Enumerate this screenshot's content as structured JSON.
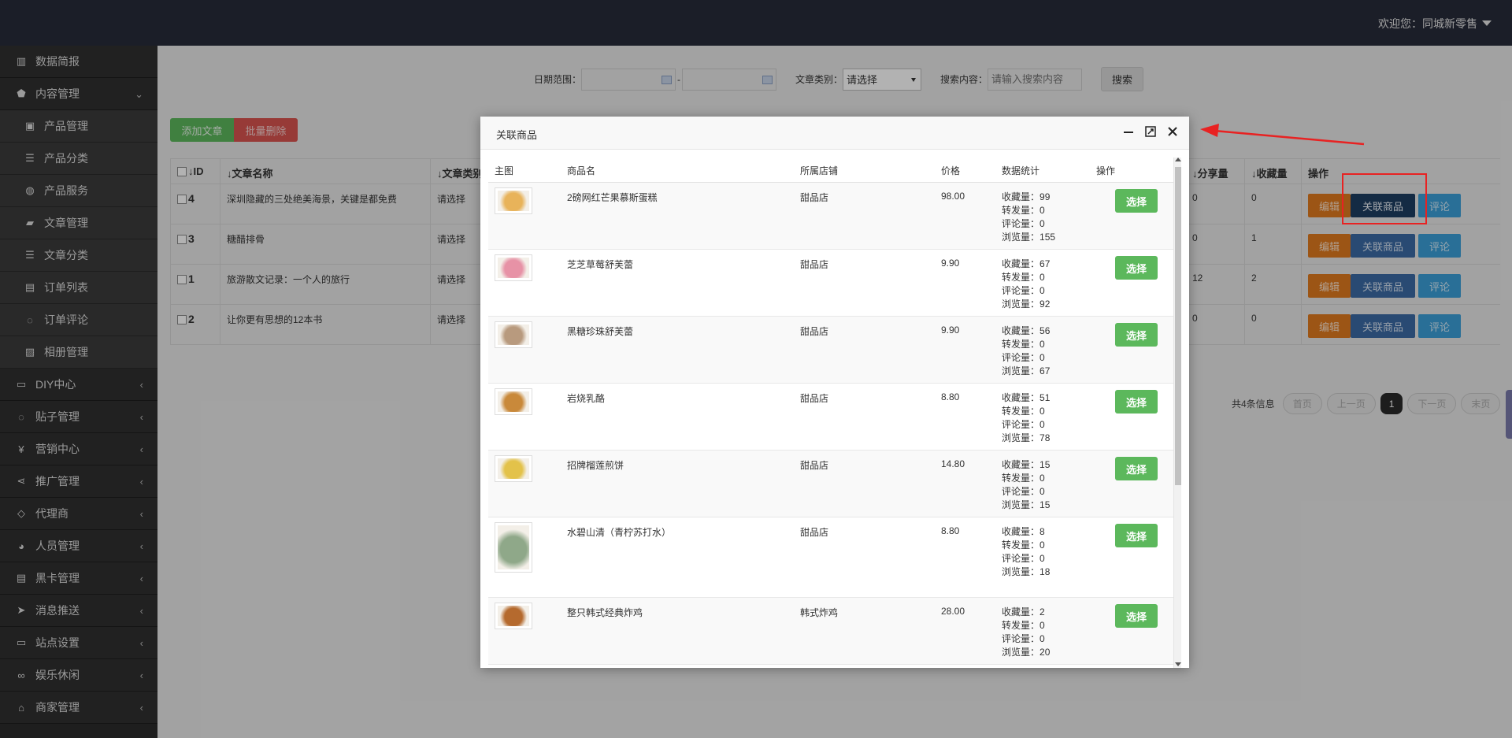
{
  "topbar": {
    "welcome": "欢迎您：同城新零售"
  },
  "sidebar": {
    "items": [
      {
        "label": "数据简报",
        "icon": "bar-chart-icon",
        "sub": false,
        "arrow": ""
      },
      {
        "label": "内容管理",
        "icon": "tags-icon",
        "sub": false,
        "arrow": "⌄"
      },
      {
        "label": "产品管理",
        "icon": "shopping-bag-icon",
        "sub": true,
        "arrow": ""
      },
      {
        "label": "产品分类",
        "icon": "list-icon",
        "sub": true,
        "arrow": ""
      },
      {
        "label": "产品服务",
        "icon": "globe-icon",
        "sub": true,
        "arrow": ""
      },
      {
        "label": "文章管理",
        "icon": "book-icon",
        "sub": true,
        "arrow": ""
      },
      {
        "label": "文章分类",
        "icon": "list-icon",
        "sub": true,
        "arrow": ""
      },
      {
        "label": "订单列表",
        "icon": "id-card-icon",
        "sub": true,
        "arrow": ""
      },
      {
        "label": "订单评论",
        "icon": "comment-icon",
        "sub": true,
        "arrow": ""
      },
      {
        "label": "相册管理",
        "icon": "image-icon",
        "sub": true,
        "arrow": ""
      },
      {
        "label": "DIY中心",
        "icon": "desktop-icon",
        "sub": false,
        "arrow": "‹"
      },
      {
        "label": "贴子管理",
        "icon": "comment-icon",
        "sub": false,
        "arrow": "‹"
      },
      {
        "label": "营销中心",
        "icon": "yen-icon",
        "sub": false,
        "arrow": "‹"
      },
      {
        "label": "推广管理",
        "icon": "share-icon",
        "sub": false,
        "arrow": "‹"
      },
      {
        "label": "代理商",
        "icon": "diamond-icon",
        "sub": false,
        "arrow": "‹"
      },
      {
        "label": "人员管理",
        "icon": "users-icon",
        "sub": false,
        "arrow": "‹"
      },
      {
        "label": "黑卡管理",
        "icon": "id-card-icon",
        "sub": false,
        "arrow": "‹"
      },
      {
        "label": "消息推送",
        "icon": "paper-plane-icon",
        "sub": false,
        "arrow": "‹"
      },
      {
        "label": "站点设置",
        "icon": "desktop-icon",
        "sub": false,
        "arrow": "‹"
      },
      {
        "label": "娱乐休闲",
        "icon": "gamepad-icon",
        "sub": false,
        "arrow": "‹"
      },
      {
        "label": "商家管理",
        "icon": "bank-icon",
        "sub": false,
        "arrow": "‹"
      }
    ],
    "icons": {
      "bar-chart-icon": "▥",
      "tags-icon": "⬟",
      "shopping-bag-icon": "▣",
      "list-icon": "☰",
      "globe-icon": "◍",
      "book-icon": "▰",
      "id-card-icon": "▤",
      "comment-icon": "◌",
      "image-icon": "▨",
      "desktop-icon": "▭",
      "yen-icon": "¥",
      "share-icon": "⋖",
      "diamond-icon": "◇",
      "users-icon": "◕",
      "paper-plane-icon": "➤",
      "gamepad-icon": "∞",
      "bank-icon": "⌂"
    }
  },
  "filter": {
    "date_label": "日期范围：",
    "date_sep": "-",
    "category_label": "文章类别：",
    "category_value": "请选择",
    "search_label": "搜索内容：",
    "search_placeholder": "请输入搜索内容",
    "search_button": "搜索"
  },
  "actions": {
    "add": "添加文章",
    "batch_delete": "批量删除"
  },
  "table": {
    "headers": {
      "id": "ID",
      "title": "文章名称",
      "category": "文章类别",
      "share": "分享量",
      "fav": "收藏量",
      "op": "操作"
    },
    "sort_arrow": "↓",
    "rows": [
      {
        "id": "4",
        "title": "深圳隐藏的三处绝美海景，关键是都免费",
        "category": "请选择",
        "share": "0",
        "fav": "0"
      },
      {
        "id": "3",
        "title": "糖醋排骨",
        "category": "请选择",
        "share": "0",
        "fav": "1"
      },
      {
        "id": "1",
        "title": "旅游散文记录：一个人的旅行",
        "category": "请选择",
        "share": "12",
        "fav": "2"
      },
      {
        "id": "2",
        "title": "让你更有思想的12本书",
        "category": "请选择",
        "share": "0",
        "fav": "0"
      }
    ],
    "op_labels": {
      "edit": "编辑",
      "link": "关联商品",
      "comment": "评论"
    }
  },
  "pager": {
    "total": "共4条信息",
    "first": "首页",
    "prev": "上一页",
    "current": "1",
    "next": "下一页",
    "last": "末页"
  },
  "modal": {
    "title": "关联商品",
    "headers": {
      "img": "主图",
      "name": "商品名",
      "shop": "所属店铺",
      "price": "价格",
      "stats": "数据统计",
      "op": "操作"
    },
    "select_label": "选择",
    "stat_labels": {
      "fav": "收藏量：",
      "share": "转发量：",
      "comment": "评论量：",
      "view": "浏览量："
    },
    "rows": [
      {
        "name": "2磅网红芒果慕斯蛋糕",
        "shop": "甜品店",
        "price": "98.00",
        "fav": "99",
        "share": "0",
        "comment": "0",
        "view": "155",
        "thumb": "#e8b35a"
      },
      {
        "name": "芝芝草莓舒芙蕾",
        "shop": "甜品店",
        "price": "9.90",
        "fav": "67",
        "share": "0",
        "comment": "0",
        "view": "92",
        "thumb": "#e792a6"
      },
      {
        "name": "黑糖珍珠舒芙蕾",
        "shop": "甜品店",
        "price": "9.90",
        "fav": "56",
        "share": "0",
        "comment": "0",
        "view": "67",
        "thumb": "#b89a7e"
      },
      {
        "name": "岩烧乳酪",
        "shop": "甜品店",
        "price": "8.80",
        "fav": "51",
        "share": "0",
        "comment": "0",
        "view": "78",
        "thumb": "#c9893a"
      },
      {
        "name": "招牌榴莲煎饼",
        "shop": "甜品店",
        "price": "14.80",
        "fav": "15",
        "share": "0",
        "comment": "0",
        "view": "15",
        "thumb": "#e3c24a"
      },
      {
        "name": "水碧山清（青柠苏打水）",
        "shop": "甜品店",
        "price": "8.80",
        "fav": "8",
        "share": "0",
        "comment": "0",
        "view": "18",
        "thumb": "#8fa889"
      },
      {
        "name": "整只韩式经典炸鸡",
        "shop": "韩式炸鸡",
        "price": "28.00",
        "fav": "2",
        "share": "0",
        "comment": "0",
        "view": "20",
        "thumb": "#b56a2e"
      }
    ]
  }
}
